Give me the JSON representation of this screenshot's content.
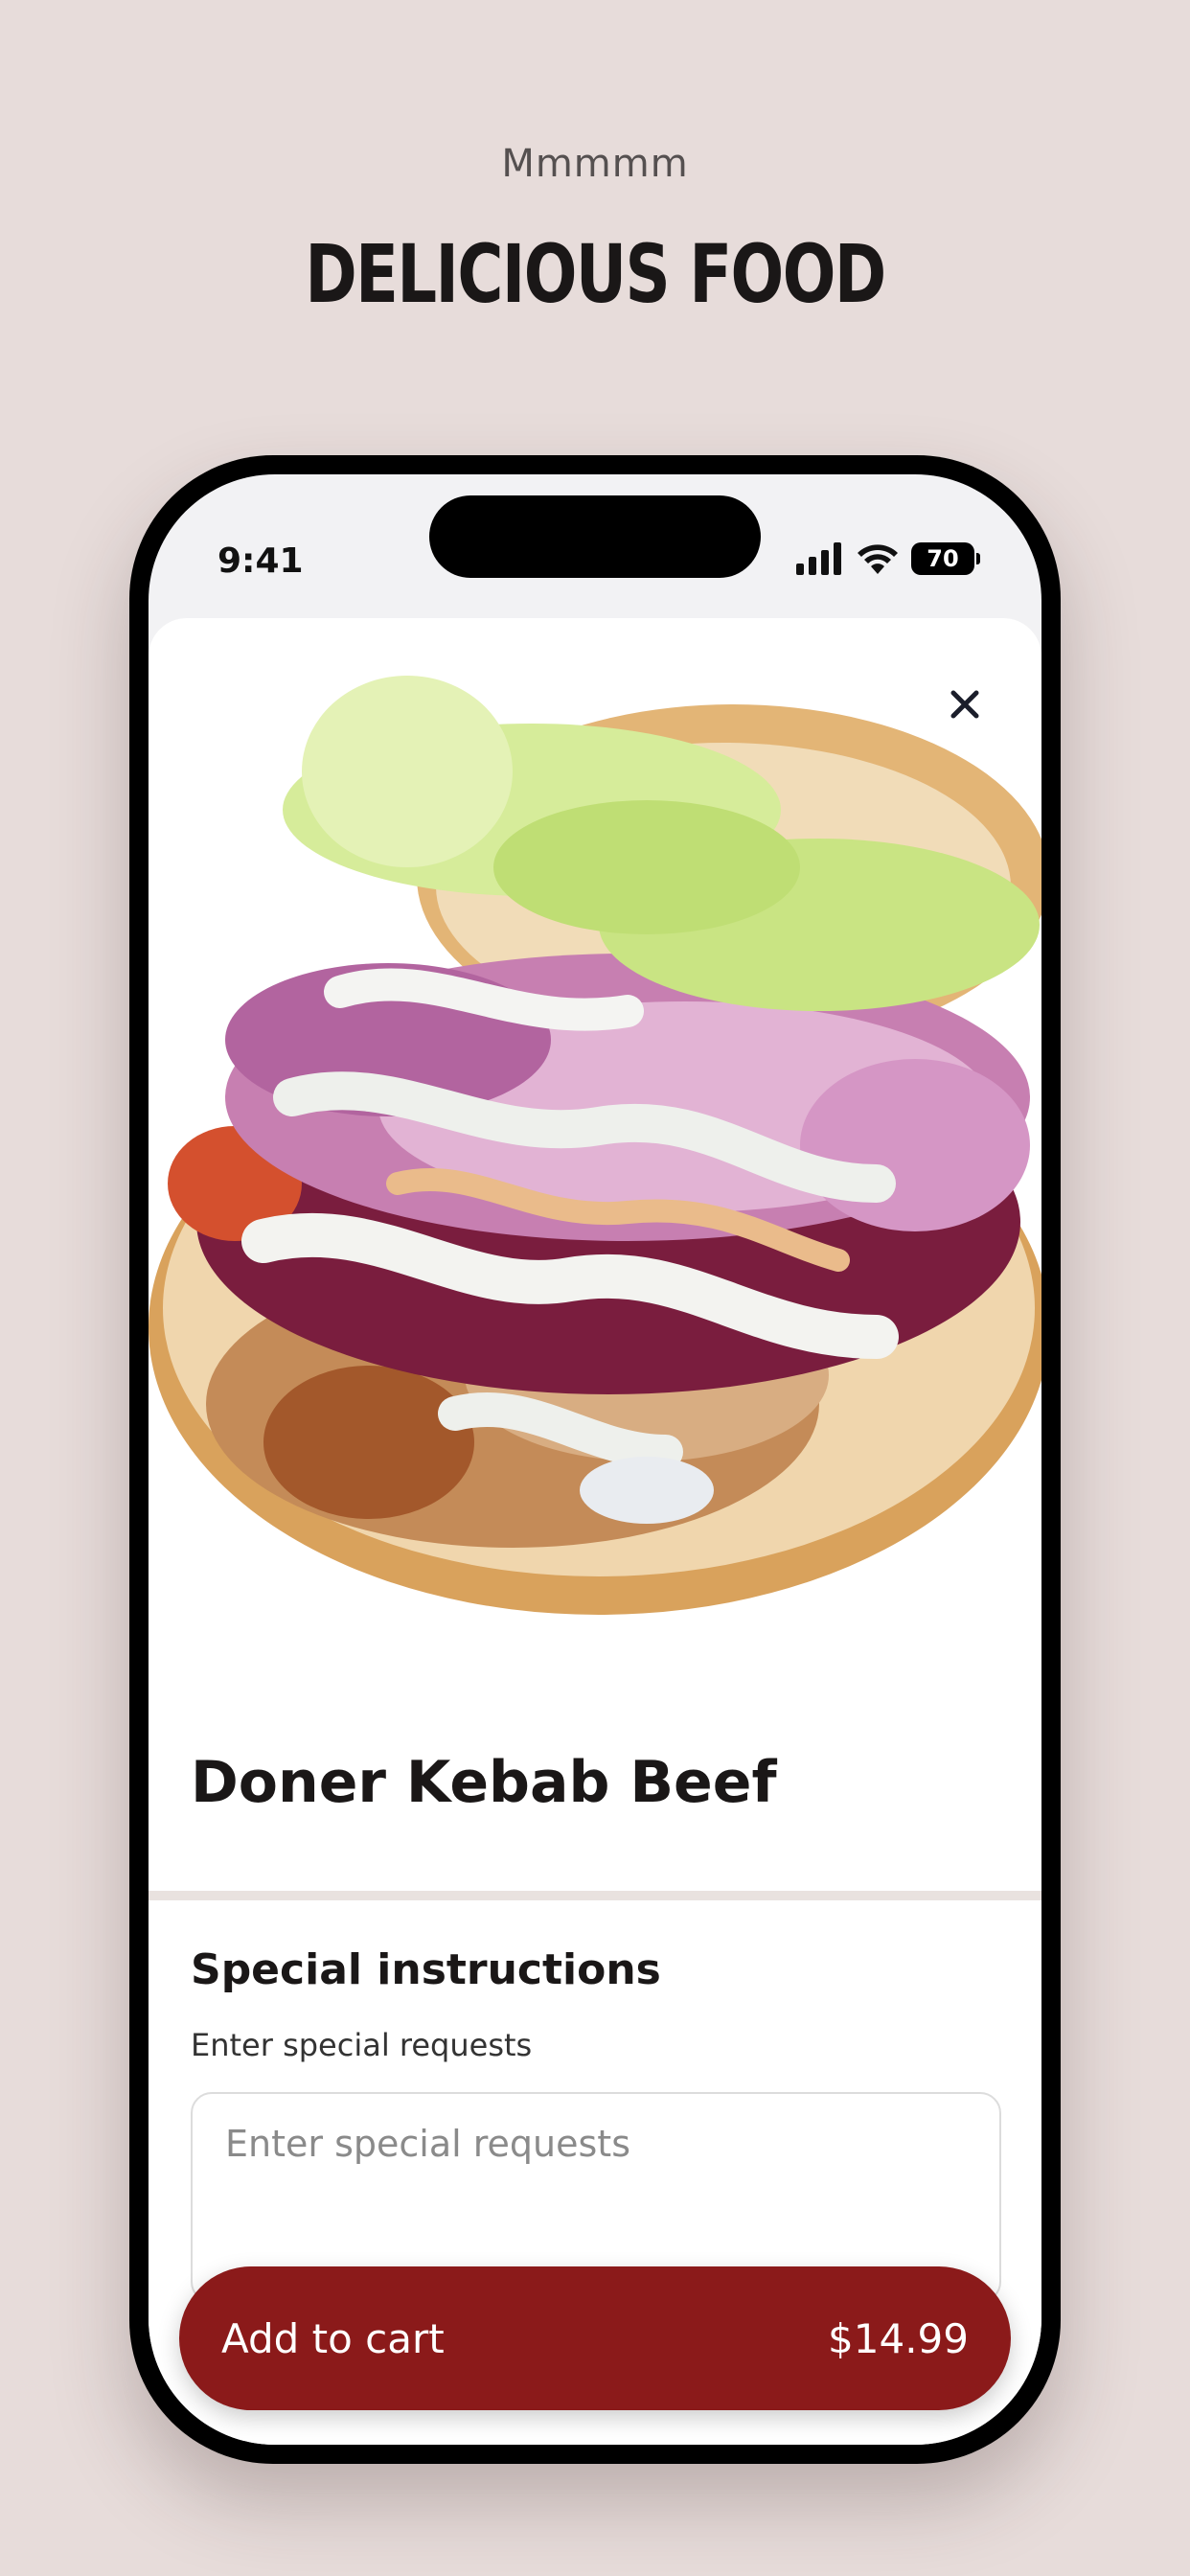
{
  "promo": {
    "eyebrow": "Mmmmm",
    "headline": "DELICIOUS FOOD"
  },
  "status_bar": {
    "time": "9:41",
    "battery": "70",
    "icons": [
      "signal-icon",
      "wifi-icon",
      "battery-icon"
    ]
  },
  "sheet": {
    "close_icon": "close-icon",
    "product_name": "Doner Kebab Beef",
    "instructions": {
      "title": "Special instructions",
      "subtitle": "Enter special requests",
      "placeholder": "Enter special requests",
      "value": ""
    },
    "cart_button": {
      "label": "Add to cart",
      "price": "$14.99"
    }
  },
  "colors": {
    "background": "#e7dcda",
    "accent": "#8b1a1a",
    "text": "#1a1717"
  }
}
